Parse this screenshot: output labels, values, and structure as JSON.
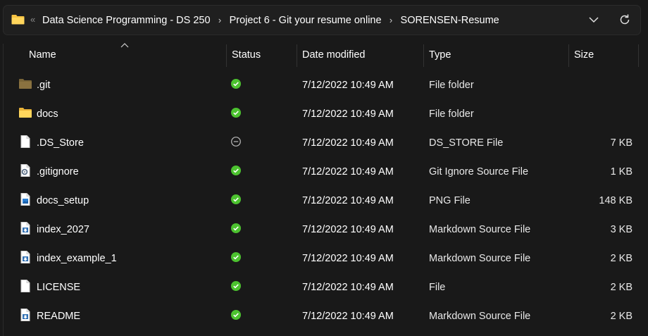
{
  "address_bar": {
    "overflow": "«",
    "breadcrumbs": [
      "Data Science Programming - DS 250",
      "Project 6 - Git your resume online",
      "SORENSEN-Resume"
    ],
    "separator": "›",
    "folder_icon": "folder-icon",
    "dropdown_icon": "chevron-down-icon",
    "refresh_icon": "refresh-icon"
  },
  "columns": {
    "name": "Name",
    "status": "Status",
    "date_modified": "Date modified",
    "type": "Type",
    "size": "Size",
    "sort_indicator": "sort-ascending-icon"
  },
  "colors": {
    "background": "#191919",
    "status_synced": "#4cc22f",
    "folder_yellow": "#f5c242",
    "git_folder": "#8a7240"
  },
  "files": [
    {
      "name": ".git",
      "icon": "folder-hidden-icon",
      "status": "synced",
      "date": "7/12/2022 10:49 AM",
      "type": "File folder",
      "size": ""
    },
    {
      "name": "docs",
      "icon": "folder-icon",
      "status": "synced",
      "date": "7/12/2022 10:49 AM",
      "type": "File folder",
      "size": ""
    },
    {
      "name": ".DS_Store",
      "icon": "blank-file-icon",
      "status": "excluded",
      "date": "7/12/2022 10:49 AM",
      "type": "DS_STORE File",
      "size": "7 KB"
    },
    {
      "name": ".gitignore",
      "icon": "settings-file-icon",
      "status": "synced",
      "date": "7/12/2022 10:49 AM",
      "type": "Git Ignore Source File",
      "size": "1 KB"
    },
    {
      "name": "docs_setup",
      "icon": "image-file-icon",
      "status": "synced",
      "date": "7/12/2022 10:49 AM",
      "type": "PNG File",
      "size": "148 KB"
    },
    {
      "name": "index_2027",
      "icon": "markdown-file-icon",
      "status": "synced",
      "date": "7/12/2022 10:49 AM",
      "type": "Markdown Source File",
      "size": "3 KB"
    },
    {
      "name": "index_example_1",
      "icon": "markdown-file-icon",
      "status": "synced",
      "date": "7/12/2022 10:49 AM",
      "type": "Markdown Source File",
      "size": "2 KB"
    },
    {
      "name": "LICENSE",
      "icon": "blank-file-icon",
      "status": "synced",
      "date": "7/12/2022 10:49 AM",
      "type": "File",
      "size": "2 KB"
    },
    {
      "name": "README",
      "icon": "markdown-file-icon",
      "status": "synced",
      "date": "7/12/2022 10:49 AM",
      "type": "Markdown Source File",
      "size": "2 KB"
    }
  ]
}
